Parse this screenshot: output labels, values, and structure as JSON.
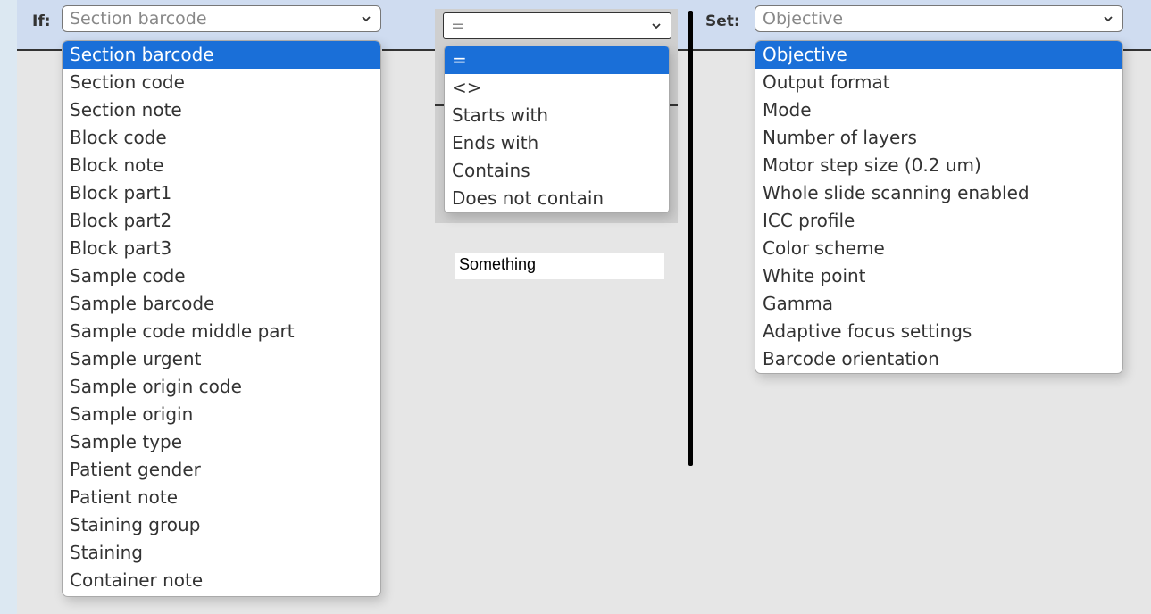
{
  "if_field": {
    "label": "If:",
    "selected": "Section barcode",
    "options": [
      "Section barcode",
      "Section code",
      "Section note",
      "Block code",
      "Block note",
      "Block part1",
      "Block part2",
      "Block part3",
      "Sample code",
      "Sample barcode",
      "Sample code middle part",
      "Sample urgent",
      "Sample origin code",
      "Sample origin",
      "Sample type",
      "Patient gender",
      "Patient note",
      "Staining group",
      "Staining",
      "Container note"
    ]
  },
  "operator": {
    "selected": "=",
    "options": [
      "=",
      "<>",
      "Starts with",
      "Ends with",
      "Contains",
      "Does not contain"
    ]
  },
  "value_input": {
    "value": "Something"
  },
  "set_field": {
    "label": "Set:",
    "selected": "Objective",
    "options": [
      "Objective",
      "Output format",
      "Mode",
      "Number of layers",
      "Motor step size (0.2 um)",
      "Whole slide scanning enabled",
      "ICC profile",
      "Color scheme",
      "White point",
      "Gamma",
      "Adaptive focus settings",
      "Barcode orientation"
    ]
  },
  "colors": {
    "header": "#cfdcf0",
    "selection": "#1a6fd8",
    "panel": "#e6e6e6"
  }
}
